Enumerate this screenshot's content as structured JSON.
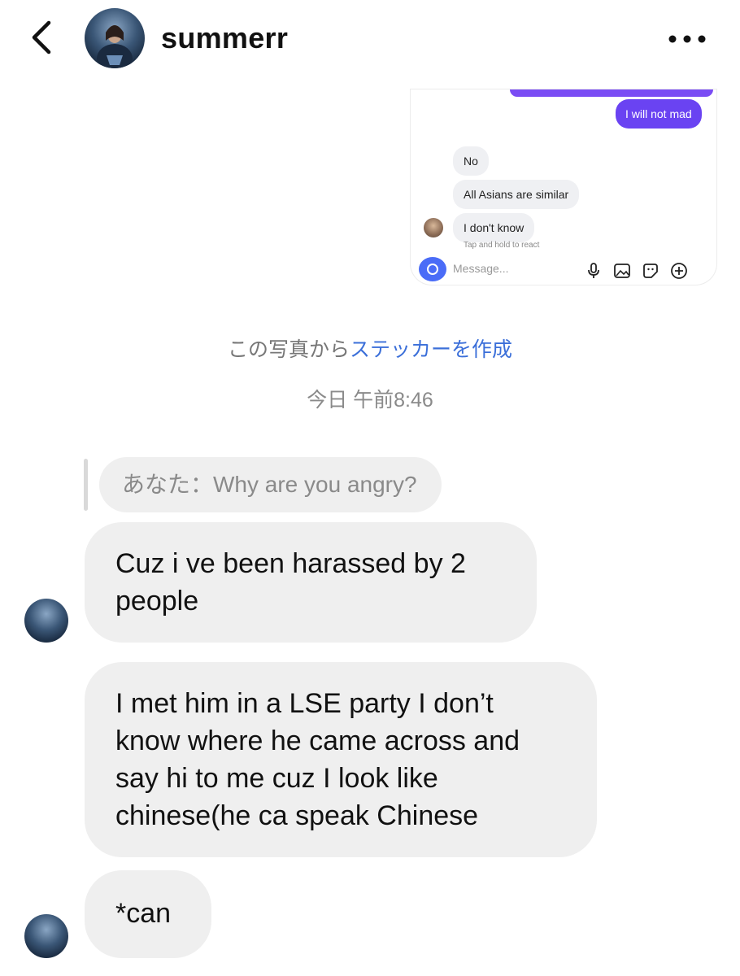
{
  "header": {
    "username": "summerr",
    "back_icon": "chevron-left-icon",
    "more_icon": "more-horizontal-icon"
  },
  "embedded_screenshot": {
    "sent_message": "I will not mad",
    "received_messages": [
      "No",
      "All Asians are similar",
      "I don't know"
    ],
    "hint": "Tap and hold to react",
    "message_placeholder": "Message...",
    "icons": [
      "camera-icon",
      "microphone-icon",
      "image-icon",
      "sticker-icon",
      "plus-circle-icon"
    ]
  },
  "sticker_prompt": {
    "prefix": "この写真から",
    "link": "ステッカーを作成"
  },
  "timestamp": "今日 午前8:46",
  "reply_quote": "あなた：Why are you angry?",
  "messages": [
    {
      "lines": [
        "Cuz i ve been harassed by 2",
        "people"
      ]
    },
    {
      "lines": [
        "I met him in a LSE party I don’t",
        "know where he came across and",
        "say hi to me cuz I look like",
        "chinese(he ca speak Chinese"
      ]
    },
    {
      "lines": [
        "*can"
      ]
    }
  ],
  "colors": {
    "sent_bubble": "#6a43f2",
    "link": "#3b6fd9",
    "received_bubble": "#efefef"
  }
}
